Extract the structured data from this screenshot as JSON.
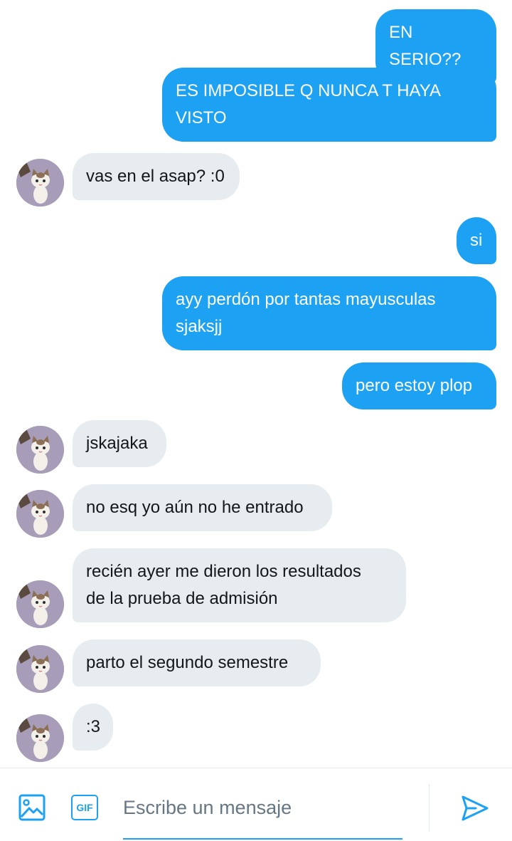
{
  "messages": [
    {
      "side": "sent",
      "text": "EN SERIO??"
    },
    {
      "side": "sent",
      "text": "ES IMPOSIBLE Q NUNCA T HAYA\nVISTO"
    },
    {
      "side": "received",
      "text": "vas en el asap? :0"
    },
    {
      "side": "sent",
      "text": "si"
    },
    {
      "side": "sent",
      "text": "ayy perdón por tantas mayusculas\nsjaksjj"
    },
    {
      "side": "sent",
      "text": "pero estoy plop"
    },
    {
      "side": "received",
      "text": "jskajaka"
    },
    {
      "side": "received",
      "text": "no esq yo aún no he entrado"
    },
    {
      "side": "received",
      "text": "recién ayer me dieron los resultados\nde la prueba de admisión"
    },
    {
      "side": "received",
      "text": "parto el segundo semestre"
    },
    {
      "side": "received",
      "text": ":3"
    }
  ],
  "composer": {
    "placeholder": "Escribe un mensaje",
    "gif_label": "GIF",
    "icons": [
      "image-icon",
      "gif-icon",
      "send-icon"
    ]
  },
  "colors": {
    "sent_bubble": "#1da1f2",
    "received_bubble": "#e6ecf0",
    "accent": "#1da1f2"
  }
}
